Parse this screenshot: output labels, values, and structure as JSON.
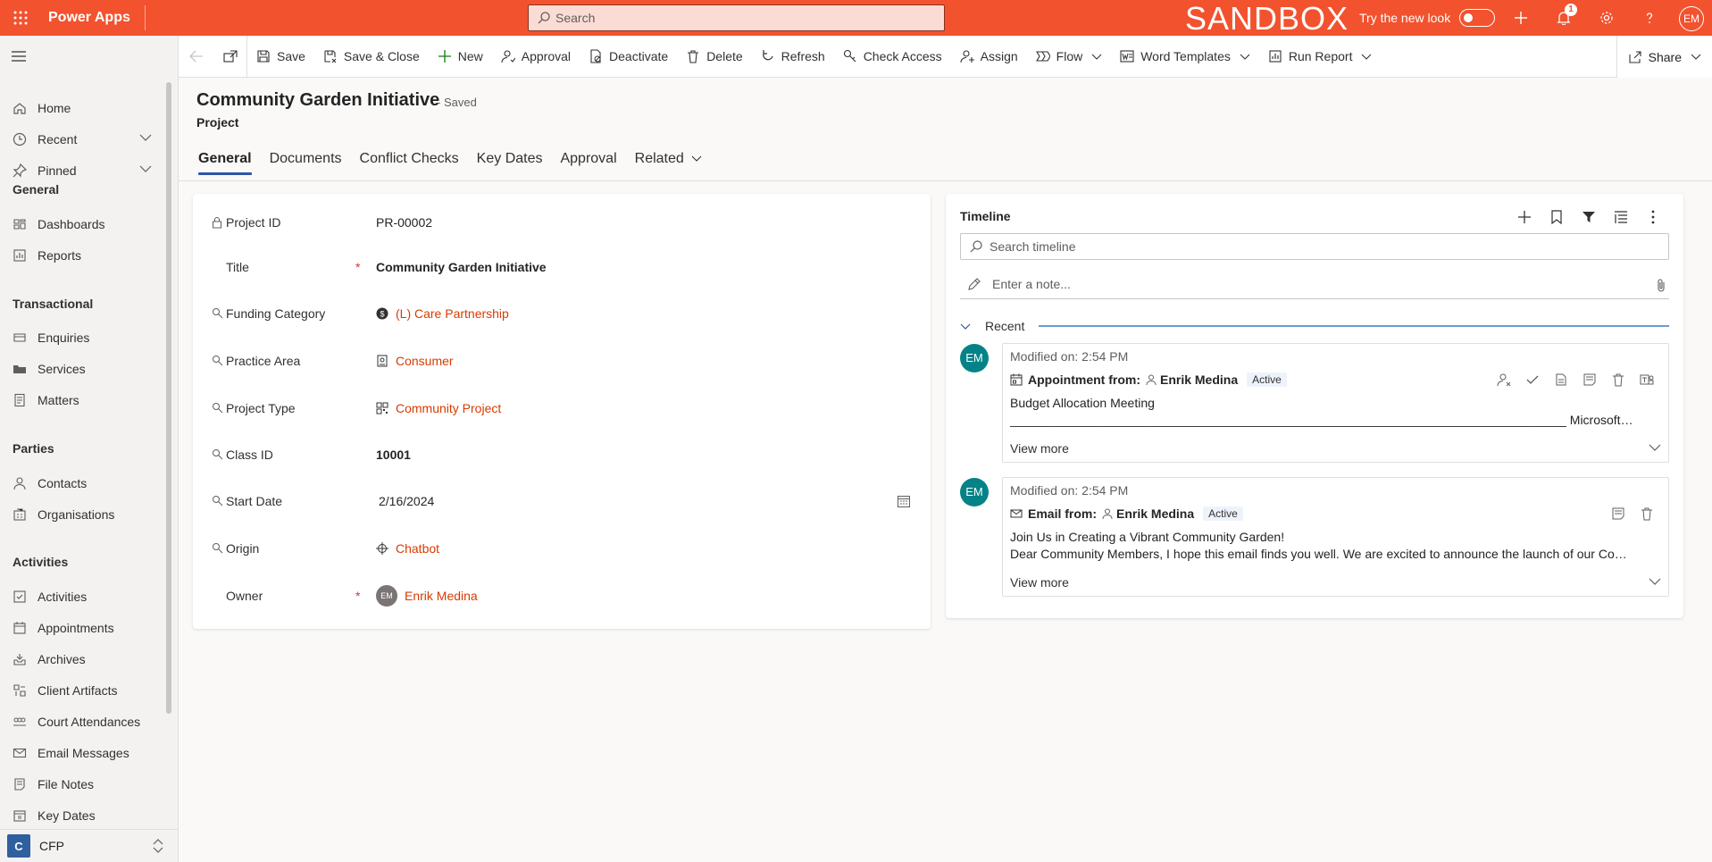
{
  "topbar": {
    "app_name": "Power Apps",
    "search_placeholder": "Search",
    "environment": "SANDBOX",
    "try_new_look": "Try the new look",
    "notification_count": "1",
    "user_initials": "EM",
    "brand_color": "#f2522e"
  },
  "nav": {
    "items_top": [
      {
        "label": "Home",
        "icon": "home-icon"
      },
      {
        "label": "Recent",
        "icon": "clock-icon"
      },
      {
        "label": "Pinned",
        "icon": "pin-icon"
      }
    ],
    "groups": [
      {
        "title": "General",
        "items": [
          "Dashboards",
          "Reports"
        ]
      },
      {
        "title": "Transactional",
        "items": [
          "Enquiries",
          "Services",
          "Matters"
        ]
      },
      {
        "title": "Parties",
        "items": [
          "Contacts",
          "Organisations"
        ]
      },
      {
        "title": "Activities",
        "items": [
          "Activities",
          "Appointments",
          "Archives",
          "Client Artifacts",
          "Court Attendances",
          "Email Messages",
          "File Notes",
          "Key Dates"
        ]
      }
    ],
    "area_badge": "C",
    "area_name": "CFP"
  },
  "commands": {
    "save": "Save",
    "save_close": "Save & Close",
    "new": "New",
    "approval": "Approval",
    "deactivate": "Deactivate",
    "delete": "Delete",
    "refresh": "Refresh",
    "check_access": "Check Access",
    "assign": "Assign",
    "flow": "Flow",
    "word_templates": "Word Templates",
    "run_report": "Run Report",
    "share": "Share"
  },
  "record": {
    "title": "Community Garden Initiative",
    "saved_status": "- Saved",
    "entity": "Project",
    "tabs": [
      "General",
      "Documents",
      "Conflict Checks",
      "Key Dates",
      "Approval",
      "Related"
    ],
    "active_tab": "General"
  },
  "form": {
    "fields": [
      {
        "label": "Project ID",
        "value": "PR-00002",
        "locked": true
      },
      {
        "label": "Title",
        "value": "Community Garden Initiative",
        "required": true
      },
      {
        "label": "Funding Category",
        "value": "(L) Care Partnership",
        "lookup": true
      },
      {
        "label": "Practice Area",
        "value": "Consumer",
        "lookup": true
      },
      {
        "label": "Project Type",
        "value": "Community Project",
        "lookup": true
      },
      {
        "label": "Class ID",
        "value": "10001"
      },
      {
        "label": "Start Date",
        "value": "2/16/2024"
      },
      {
        "label": "Origin",
        "value": "Chatbot",
        "lookup": true
      },
      {
        "label": "Owner",
        "value": "Enrik Medina",
        "required": true,
        "initials": "EM"
      }
    ],
    "required_mark": "*"
  },
  "timeline": {
    "title": "Timeline",
    "search_placeholder": "Search timeline",
    "note_placeholder": "Enter a note...",
    "recent_label": "Recent",
    "items": [
      {
        "initials": "EM",
        "modified": "Modified on: 2:54 PM",
        "type_label": "Appointment from:",
        "person": "Enrik Medina",
        "status": "Active",
        "subject": "Budget Allocation Meeting",
        "body": "________________________________________________________________________________ Microsoft Teams Need help? Join th...",
        "view_more": "View more"
      },
      {
        "initials": "EM",
        "modified": "Modified on: 2:54 PM",
        "type_label": "Email from:",
        "person": "Enrik Medina",
        "status": "Active",
        "subject": "Join Us in Creating a Vibrant Community Garden!",
        "body": "Dear Community Members, I hope this email finds you well. We are excited to announce the launch of our Com...",
        "view_more": "View more"
      }
    ]
  }
}
